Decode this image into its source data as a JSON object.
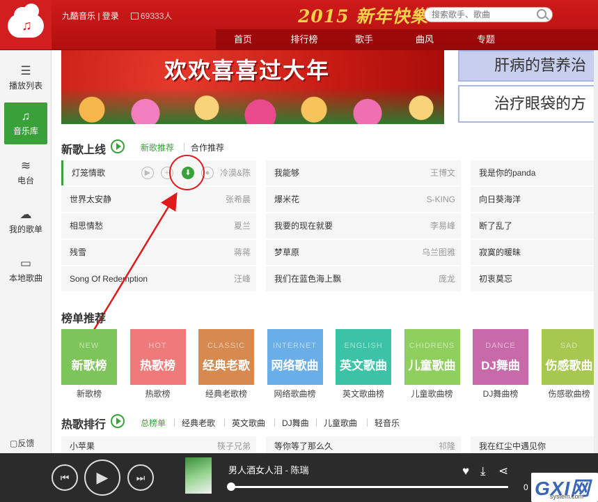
{
  "header": {
    "site_name": "九酷音乐 | 登录",
    "online": "69333人",
    "festive": "2015 新年快樂",
    "search_placeholder": "搜索歌手、歌曲",
    "nav": [
      "首页",
      "排行榜",
      "歌手",
      "曲风",
      "专题"
    ]
  },
  "sidebar": {
    "items": [
      "播放列表",
      "音乐库",
      "电台",
      "我的歌单",
      "本地歌曲"
    ],
    "feedback": "反馈"
  },
  "banner": {
    "text": "欢欢喜喜过大年"
  },
  "ads": [
    "肝病的营养治",
    "治疗眼袋的方"
  ],
  "new_songs": {
    "title": "新歌上线",
    "tabs": [
      "新歌推荐",
      "合作推荐"
    ],
    "songs": [
      {
        "name": "灯笼情歌",
        "artist": "冷漠&陈"
      },
      {
        "name": "我能够",
        "artist": "王博文"
      },
      {
        "name": "我是你的panda",
        "artist": ""
      },
      {
        "name": "世界太安静",
        "artist": "张希晨"
      },
      {
        "name": "爆米花",
        "artist": "S-KING"
      },
      {
        "name": "向日葵海洋",
        "artist": ""
      },
      {
        "name": "相思情愁",
        "artist": "夏兰"
      },
      {
        "name": "我要的现在就要",
        "artist": "李易峰"
      },
      {
        "name": "断了乱了",
        "artist": ""
      },
      {
        "name": "残雪",
        "artist": "蒋蒋"
      },
      {
        "name": "梦草原",
        "artist": "乌兰图雅"
      },
      {
        "name": "寂寞的暖昧",
        "artist": ""
      },
      {
        "name": "Song Of Redemption",
        "artist": "汪峰"
      },
      {
        "name": "我们在蓝色海上飘",
        "artist": "庞龙"
      },
      {
        "name": "初衷莫忘",
        "artist": ""
      }
    ]
  },
  "rankings": {
    "title": "榜单推荐",
    "cards": [
      {
        "en": "NEW",
        "cn": "新歌榜",
        "label": "新歌榜",
        "color": "#7dc45a"
      },
      {
        "en": "HOT",
        "cn": "热歌榜",
        "label": "热歌榜",
        "color": "#ee7a7a"
      },
      {
        "en": "CLASSIC",
        "cn": "经典老歌",
        "label": "经典老歌榜",
        "color": "#d68a4f"
      },
      {
        "en": "INTERNET",
        "cn": "网络歌曲",
        "label": "网络歌曲榜",
        "color": "#6aaee8"
      },
      {
        "en": "ENGLISH",
        "cn": "英文歌曲",
        "label": "英文歌曲榜",
        "color": "#3cc2a6"
      },
      {
        "en": "CHIDRENS",
        "cn": "儿童歌曲",
        "label": "儿童歌曲榜",
        "color": "#8fcf5e"
      },
      {
        "en": "DANCE",
        "cn": "DJ舞曲",
        "label": "DJ舞曲榜",
        "color": "#c86aa9"
      },
      {
        "en": "SAD",
        "cn": "伤感歌曲",
        "label": "伤感歌曲榜",
        "color": "#a6c750"
      }
    ]
  },
  "hot": {
    "title": "热歌排行",
    "tabs": [
      "总榜单",
      "经典老歌",
      "英文歌曲",
      "DJ舞曲",
      "儿童歌曲",
      "轻音乐"
    ],
    "rows": [
      {
        "name": "小苹果",
        "artist": "筷子兄弟"
      },
      {
        "name": "等你等了那么久",
        "artist": "祁隆"
      },
      {
        "name": "我在红尘中遇见你",
        "artist": ""
      }
    ]
  },
  "player": {
    "now_playing": "男人酒女人泪 - 陈瑞",
    "time": "0",
    "progress": 0.0
  },
  "watermark": {
    "text": "GXI网",
    "sub": "system.com"
  }
}
